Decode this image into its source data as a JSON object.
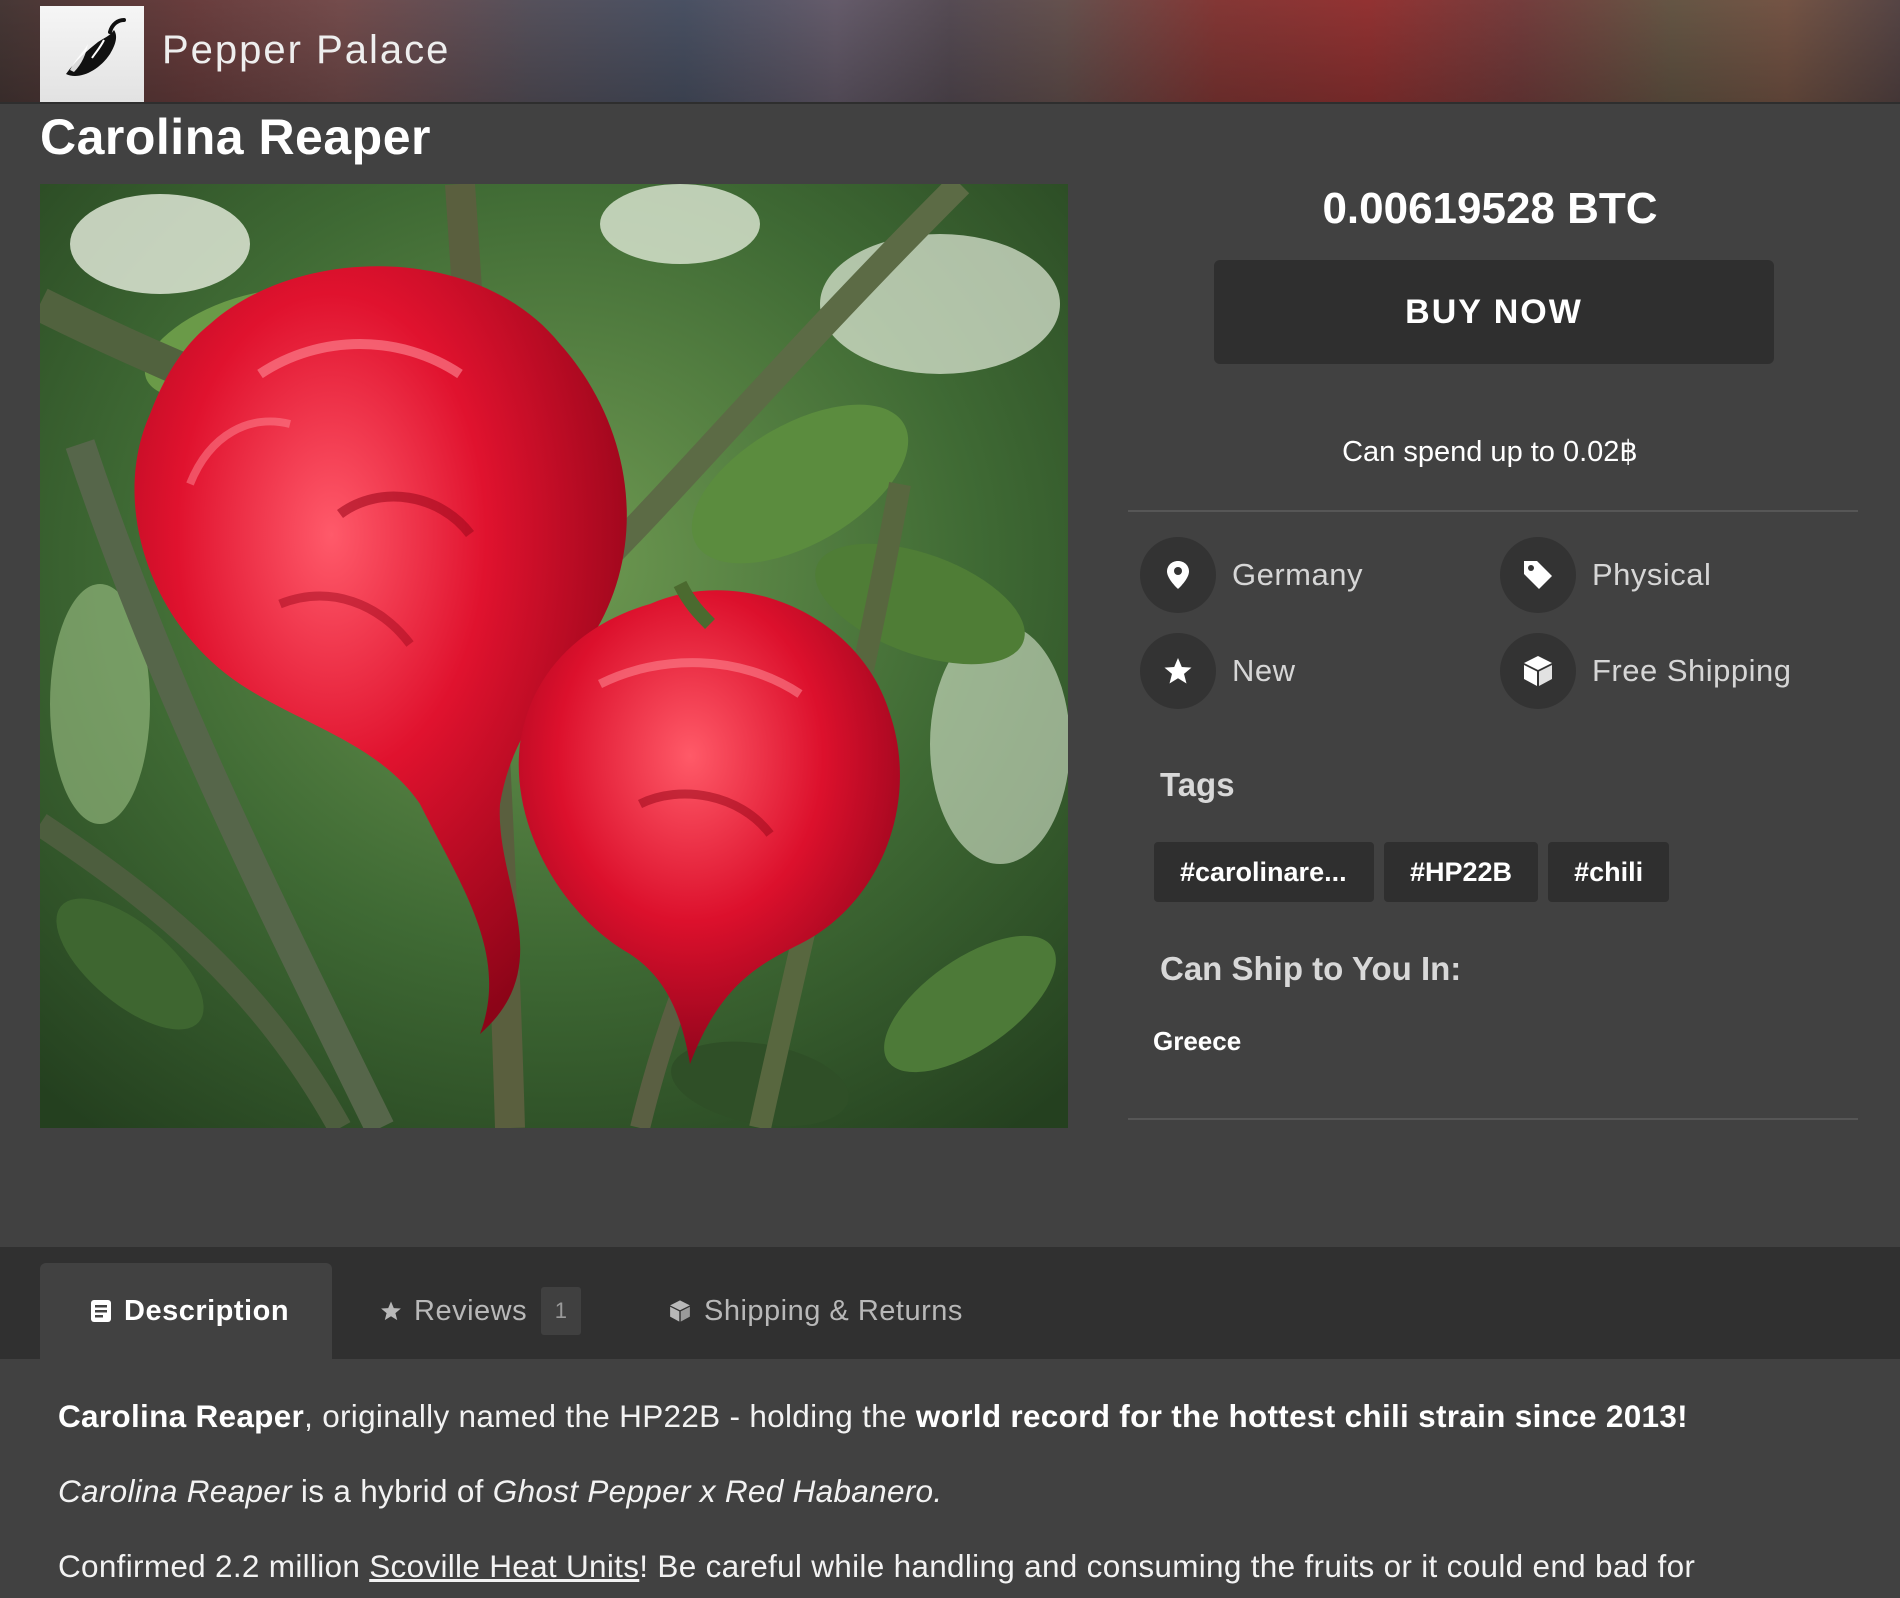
{
  "store": {
    "name": "Pepper Palace",
    "logo_icon": "chili-pepper-icon"
  },
  "product": {
    "title": "Carolina Reaper",
    "image_alt": "Carolina Reaper"
  },
  "purchase": {
    "price": "0.00619528 BTC",
    "buy_label": "BUY NOW",
    "spend_limit": "Can spend up to 0.02฿"
  },
  "features": {
    "location": {
      "label": "Germany",
      "icon": "map-pin-icon"
    },
    "type": {
      "label": "Physical",
      "icon": "tag-icon"
    },
    "condition": {
      "label": "New",
      "icon": "star-icon"
    },
    "shipping": {
      "label": "Free Shipping",
      "icon": "box-icon"
    }
  },
  "tags": {
    "heading": "Tags",
    "items": [
      "#carolinare...",
      "#HP22B",
      "#chili"
    ]
  },
  "ship_to": {
    "heading": "Can Ship to You In:",
    "countries": [
      "Greece"
    ]
  },
  "tabs": {
    "description": {
      "label": "Description",
      "icon": "document-icon"
    },
    "reviews": {
      "label": "Reviews",
      "count": "1",
      "icon": "star-icon"
    },
    "shipping": {
      "label": "Shipping & Returns",
      "icon": "box-icon"
    }
  },
  "description": {
    "p1_bold1": "Carolina Reaper",
    "p1_text": ", originally named the HP22B - holding the ",
    "p1_bold2": "world record for the hottest chili strain since 2013!",
    "p2_italic1": "Carolina Reaper",
    "p2_text": " is a hybrid of ",
    "p2_italic2": "Ghost Pepper x Red Habanero.",
    "p3_text1": "Confirmed 2.2 million ",
    "p3_link": "Scoville Heat Units",
    "p3_text2": "! Be careful while handling and consuming the fruits or it could end bad for"
  },
  "colors": {
    "background": "#414141",
    "panel_dark": "#2f2f2f",
    "tab_bar": "#303030",
    "text": "#ffffff",
    "muted_text": "#d6d6d6"
  }
}
